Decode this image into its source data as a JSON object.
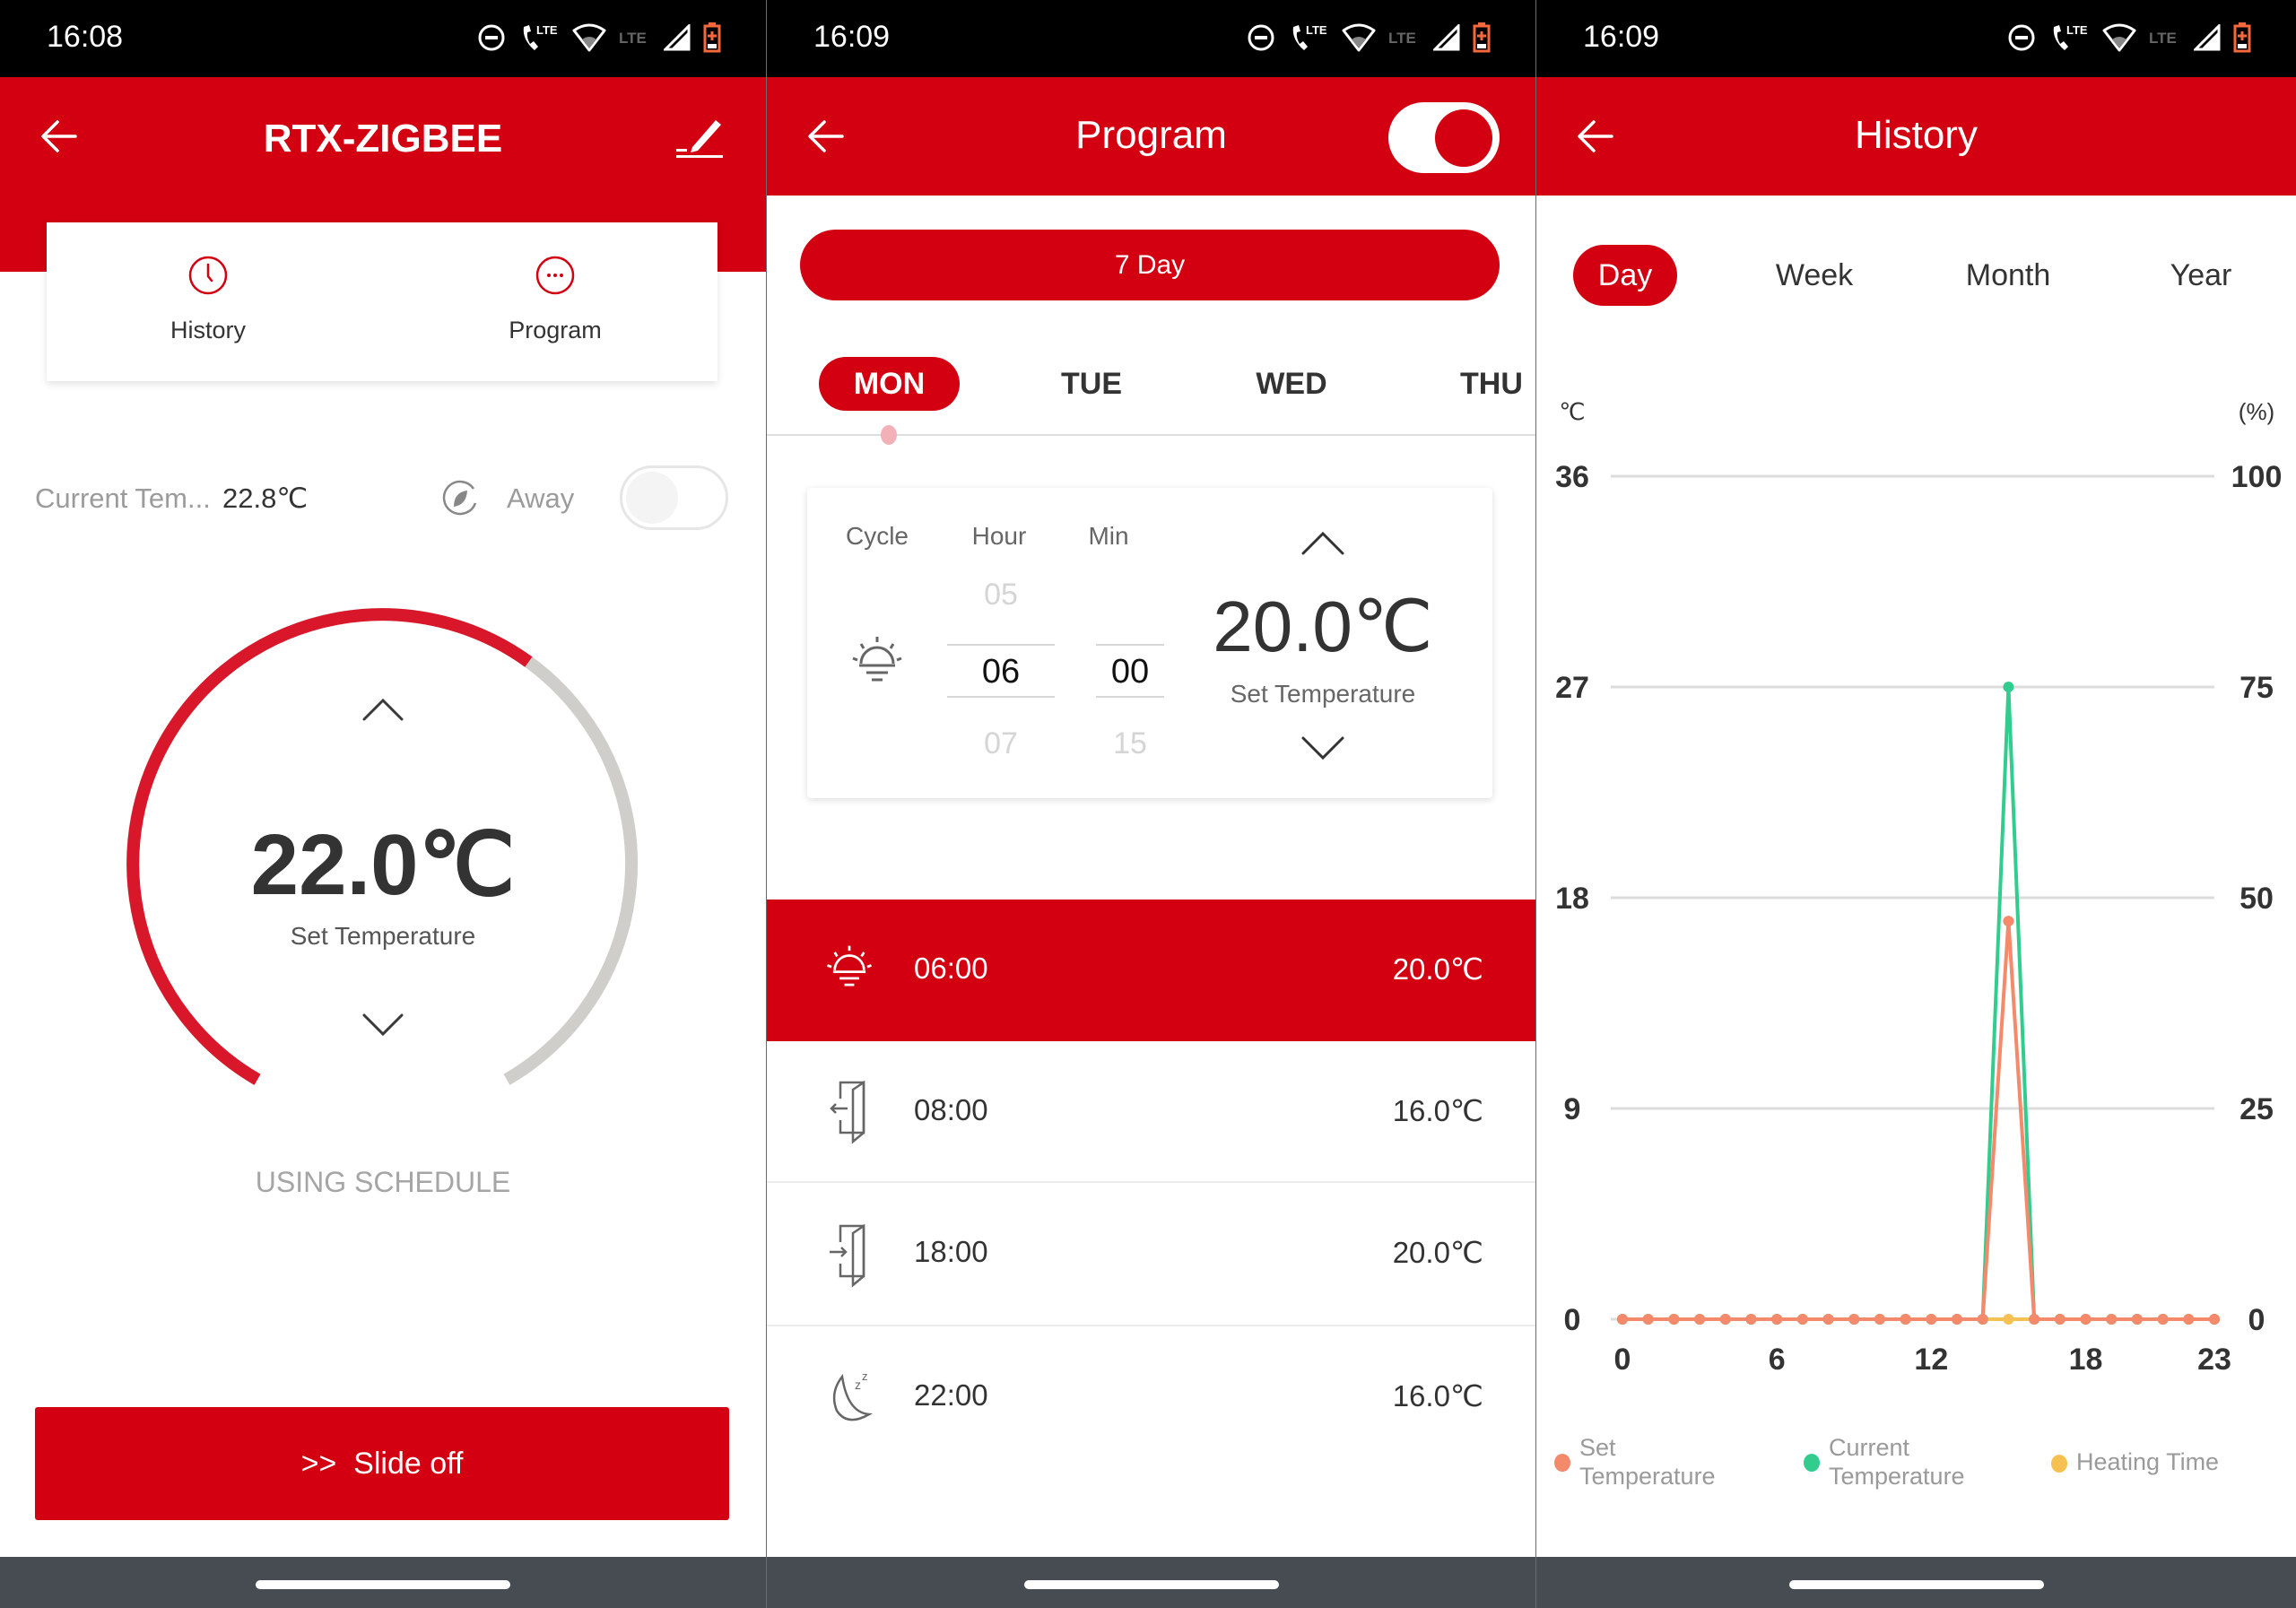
{
  "brand_color": "#d20010",
  "panels": {
    "device": {
      "status_time": "16:08",
      "title": "RTX-ZIGBEE",
      "back_icon": "arrow-left-icon",
      "edit_icon": "edit-pencil-icon",
      "shortcuts": [
        {
          "label": "History",
          "icon": "clock-icon"
        },
        {
          "label": "Program",
          "icon": "ellipsis-circle-icon"
        }
      ],
      "current_temp_label": "Current Tem...",
      "current_temp_value": "22.8℃",
      "away_label": "Away",
      "away_icon": "leaf-icon",
      "away_enabled": false,
      "dial": {
        "value": "22.0℃",
        "label": "Set Temperature",
        "fill_fraction": 0.62
      },
      "mode_text": "USING SCHEDULE",
      "slide_button": ">>  Slide off"
    },
    "program": {
      "status_time": "16:09",
      "title": "Program",
      "program_enabled": true,
      "mode_button": "7 Day",
      "days": [
        {
          "label": "MON",
          "selected": true
        },
        {
          "label": "TUE",
          "selected": false
        },
        {
          "label": "WED",
          "selected": false
        },
        {
          "label": "THU",
          "selected": false
        }
      ],
      "editor": {
        "cycle_label": "Cycle",
        "hour_label": "Hour",
        "min_label": "Min",
        "cycle_icon": "sunrise-icon",
        "hour_prev": "05",
        "hour_value": "06",
        "hour_next": "07",
        "min_value": "00",
        "min_next": "15",
        "temp_value": "20.0℃",
        "temp_label": "Set Temperature"
      },
      "schedule": [
        {
          "icon": "sunrise-icon",
          "time": "06:00",
          "temp": "20.0℃",
          "active": true
        },
        {
          "icon": "leave-home-icon",
          "time": "08:00",
          "temp": "16.0℃",
          "active": false
        },
        {
          "icon": "return-home-icon",
          "time": "18:00",
          "temp": "20.0℃",
          "active": false
        },
        {
          "icon": "sleep-moon-icon",
          "time": "22:00",
          "temp": "16.0℃",
          "active": false
        }
      ]
    },
    "history": {
      "status_time": "16:09",
      "title": "History",
      "tabs": [
        {
          "label": "Day",
          "selected": true
        },
        {
          "label": "Week",
          "selected": false
        },
        {
          "label": "Month",
          "selected": false
        },
        {
          "label": "Year",
          "selected": false
        }
      ]
    }
  },
  "chart_data": {
    "type": "line",
    "title": "",
    "xlabel": "",
    "ylabel": "℃",
    "y2label": "(%)",
    "x": [
      0,
      1,
      2,
      3,
      4,
      5,
      6,
      7,
      8,
      9,
      10,
      11,
      12,
      13,
      14,
      15,
      16,
      17,
      18,
      19,
      20,
      21,
      22,
      23
    ],
    "x_ticks": [
      "0",
      "6",
      "12",
      "18",
      "23"
    ],
    "x_tick_values": [
      0,
      6,
      12,
      18,
      23
    ],
    "ylim": [
      0,
      36
    ],
    "y_ticks": [
      "0",
      "9",
      "18",
      "27",
      "36"
    ],
    "y2lim": [
      0,
      100
    ],
    "y2_ticks": [
      "0",
      "25",
      "50",
      "75",
      "100"
    ],
    "grid": true,
    "legend_position": "bottom",
    "series": [
      {
        "name": "Set Temperature",
        "color": "#f4896b",
        "axis": "left",
        "values": [
          0,
          0,
          0,
          0,
          0,
          0,
          0,
          0,
          0,
          0,
          0,
          0,
          0,
          0,
          0,
          17,
          0,
          0,
          0,
          0,
          0,
          0,
          0,
          0
        ]
      },
      {
        "name": "Current Temperature",
        "color": "#33cc8f",
        "axis": "left",
        "values": [
          0,
          0,
          0,
          0,
          0,
          0,
          0,
          0,
          0,
          0,
          0,
          0,
          0,
          0,
          0,
          27,
          0,
          0,
          0,
          0,
          0,
          0,
          0,
          0
        ]
      },
      {
        "name": "Heating Time",
        "color": "#f6c152",
        "axis": "right",
        "values": [
          0,
          0,
          0,
          0,
          0,
          0,
          0,
          0,
          0,
          0,
          0,
          0,
          0,
          0,
          0,
          0,
          0,
          0,
          0,
          0,
          0,
          0,
          0,
          0
        ]
      }
    ]
  }
}
